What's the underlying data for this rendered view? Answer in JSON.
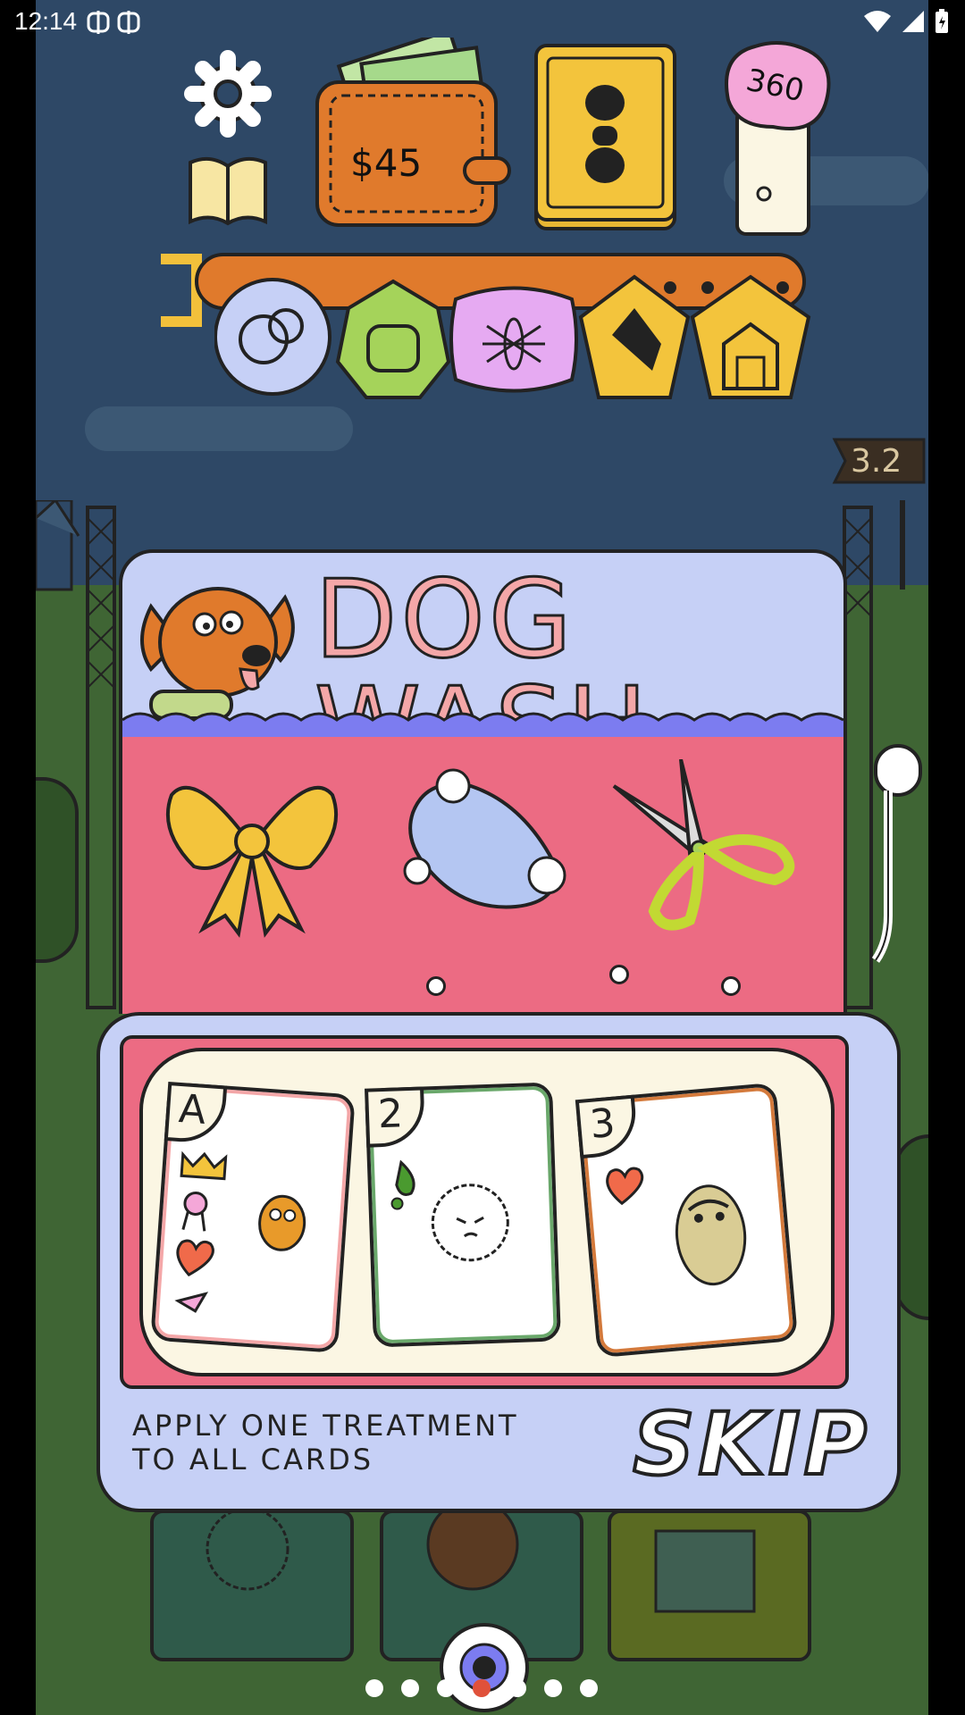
{
  "status_bar": {
    "time": "12:14",
    "notif_icons": [
      "bug-icon",
      "bug-icon"
    ],
    "right_icons": [
      "wifi-icon",
      "signal-icon",
      "battery-icon"
    ]
  },
  "hud": {
    "money": "$45",
    "score": "360",
    "level_sign": "3.2",
    "icons": [
      "settings-gear-icon",
      "guide-book-icon",
      "wallet-icon",
      "card-deck-icon",
      "paw-score-icon"
    ]
  },
  "collar_tags": [
    "bubbles-tag",
    "paw-tag",
    "ant-tag",
    "dog-head-tag",
    "barn-tag"
  ],
  "panel": {
    "title": "DOG WASH",
    "treatments": [
      "bow-treatment",
      "soap-treatment",
      "scissors-treatment"
    ]
  },
  "cards": [
    {
      "rank": "A",
      "symbols": [
        "crown",
        "ribbon",
        "heart",
        "collar-tag"
      ]
    },
    {
      "rank": "2",
      "symbols": [
        "drop"
      ]
    },
    {
      "rank": "3",
      "symbols": [
        "heart"
      ]
    }
  ],
  "tray": {
    "instruction_line1": "APPLY ONE TREATMENT",
    "instruction_line2": "TO ALL CARDS",
    "skip_label": "SKIP"
  },
  "pager": {
    "count": 7,
    "active": 3
  },
  "colors": {
    "sky": "#2e4866",
    "grass": "#3f6534",
    "panel_blue": "#c6d0f6",
    "panel_pink": "#ec6b83",
    "title_pink": "#f4a7a8",
    "accent_orange": "#e07a2c"
  }
}
